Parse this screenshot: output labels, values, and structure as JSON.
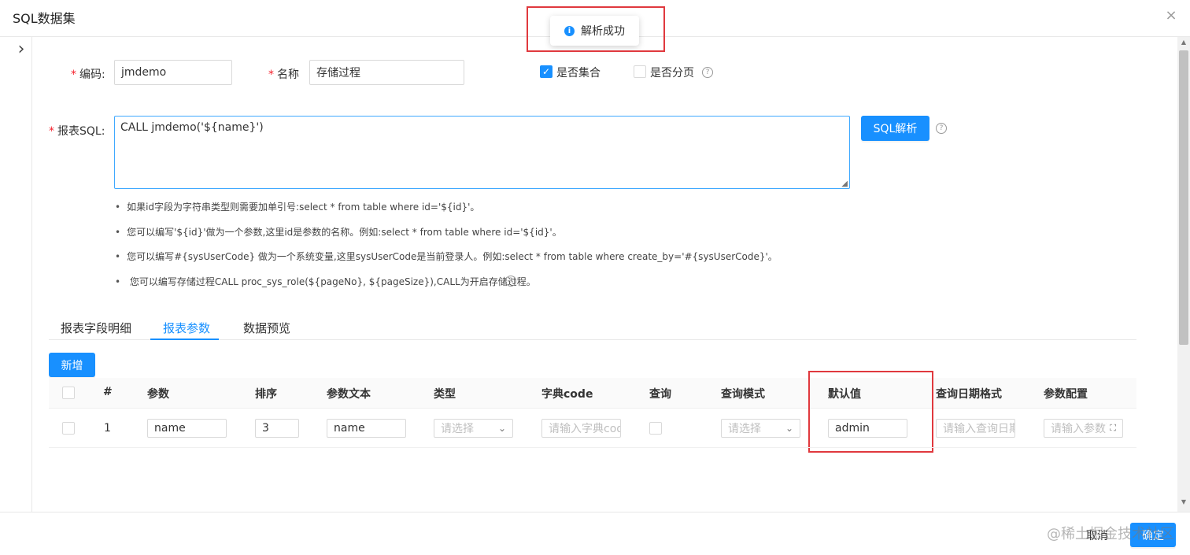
{
  "modal": {
    "title": "SQL数据集",
    "close": "×",
    "expand": "›"
  },
  "toast": {
    "message": "解析成功",
    "icon": "info-icon"
  },
  "form": {
    "code_label": "编码:",
    "code_value": "jmdemo",
    "name_label": "名称",
    "name_value": "存储过程",
    "is_collection_label": "是否集合",
    "is_paged_label": "是否分页",
    "sql_label": "报表SQL:",
    "sql_value": "CALL  jmdemo('${name}')",
    "parse_button": "SQL解析"
  },
  "tips": [
    "如果id字段为字符串类型则需要加单引号:select * from table where id='${id}'。",
    "您可以编写'${id}'做为一个参数,这里id是参数的名称。例如:select * from table where id='${id}'。",
    "您可以编写#{sysUserCode} 做为一个系统变量,这里sysUserCode是当前登录人。例如:select * from table where create_by='#{sysUserCode}'。",
    "您可以编写存储过程CALL proc_sys_role(${pageNo}, ${pageSize}),CALL为开启存储过程。"
  ],
  "tabs": [
    {
      "label": "报表字段明细",
      "active": false
    },
    {
      "label": "报表参数",
      "active": true
    },
    {
      "label": "数据预览",
      "active": false
    }
  ],
  "add_button": "新增",
  "table": {
    "headers": [
      "#",
      "参数",
      "排序",
      "参数文本",
      "类型",
      "字典code",
      "查询",
      "查询模式",
      "默认值",
      "查询日期格式",
      "参数配置"
    ],
    "rows": [
      {
        "index": "1",
        "param": "name",
        "order": "3",
        "param_text": "name",
        "type_placeholder": "请选择",
        "dict_placeholder": "请输入字典code",
        "mode_placeholder": "请选择",
        "default_value": "admin",
        "date_format_placeholder": "请输入查询日期格式",
        "config_placeholder": "请输入参数配置"
      }
    ]
  },
  "footer": {
    "cancel": "取消",
    "ok": "确定",
    "watermark": "@稀土掘金技术社区"
  },
  "colors": {
    "primary": "#1890ff",
    "highlight": "#e0393e"
  }
}
